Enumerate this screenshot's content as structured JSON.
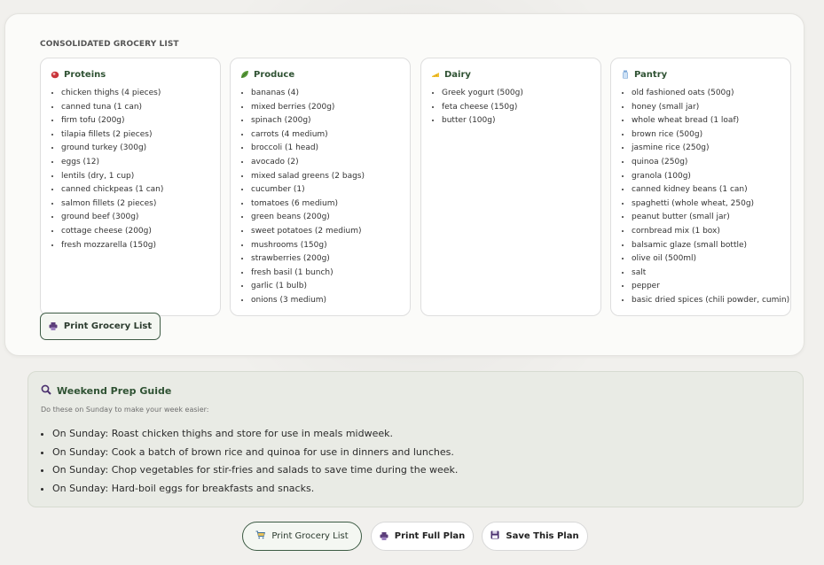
{
  "grocery": {
    "title": "CONSOLIDATED GROCERY LIST",
    "categories": [
      {
        "name": "Proteins",
        "icon": "meat-icon",
        "items": [
          "chicken thighs (4 pieces)",
          "canned tuna (1 can)",
          "firm tofu (200g)",
          "tilapia fillets (2 pieces)",
          "ground turkey (300g)",
          "eggs (12)",
          "lentils (dry, 1 cup)",
          "canned chickpeas (1 can)",
          "salmon fillets (2 pieces)",
          "ground beef (300g)",
          "cottage cheese (200g)",
          "fresh mozzarella (150g)"
        ]
      },
      {
        "name": "Produce",
        "icon": "leafy-green-icon",
        "items": [
          "bananas (4)",
          "mixed berries (200g)",
          "spinach (200g)",
          "carrots (4 medium)",
          "broccoli (1 head)",
          "avocado (2)",
          "mixed salad greens (2 bags)",
          "cucumber (1)",
          "tomatoes (6 medium)",
          "green beans (200g)",
          "sweet potatoes (2 medium)",
          "mushrooms (150g)",
          "strawberries (200g)",
          "fresh basil (1 bunch)",
          "garlic (1 bulb)",
          "onions (3 medium)"
        ]
      },
      {
        "name": "Dairy",
        "icon": "cheese-icon",
        "items": [
          "Greek yogurt (500g)",
          "feta cheese (150g)",
          "butter (100g)"
        ]
      },
      {
        "name": "Pantry",
        "icon": "jar-icon",
        "items": [
          "old fashioned oats (500g)",
          "honey (small jar)",
          "whole wheat bread (1 loaf)",
          "brown rice (500g)",
          "jasmine rice (250g)",
          "quinoa (250g)",
          "granola (100g)",
          "canned kidney beans (1 can)",
          "spaghetti (whole wheat, 250g)",
          "peanut butter (small jar)",
          "cornbread mix (1 box)",
          "balsamic glaze (small bottle)",
          "olive oil (500ml)",
          "salt",
          "pepper",
          "basic dried spices (chili powder, cumin)"
        ]
      }
    ],
    "print_label": "Print Grocery List"
  },
  "prep": {
    "title": "Weekend Prep Guide",
    "subtitle": "Do these on Sunday to make your week easier:",
    "items": [
      "On Sunday: Roast chicken thighs and store for use in meals midweek.",
      "On Sunday: Cook a batch of brown rice and quinoa for use in dinners and lunches.",
      "On Sunday: Chop vegetables for stir-fries and salads to save time during the week.",
      "On Sunday: Hard-boil eggs for breakfasts and snacks."
    ]
  },
  "actions": {
    "print_grocery": "Print Grocery List",
    "print_full": "Print Full Plan",
    "save_plan": "Save This Plan"
  },
  "colors": {
    "accent_green": "#2f5233",
    "border_green": "#3d5b44",
    "printer_purple": "#5b3d7a"
  }
}
